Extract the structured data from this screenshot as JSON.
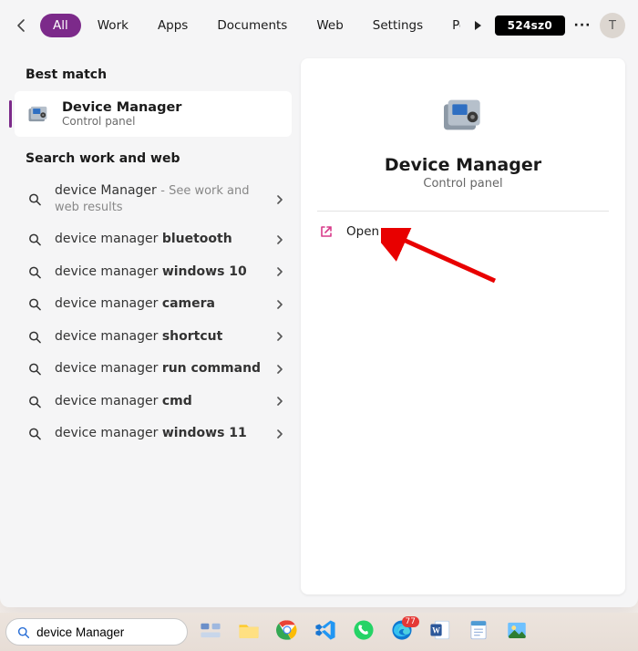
{
  "header": {
    "tabs": [
      "All",
      "Work",
      "Apps",
      "Documents",
      "Web",
      "Settings",
      "People"
    ],
    "active_tab_index": 0,
    "badge": "524sz0",
    "avatar_initial": "T"
  },
  "left": {
    "best_match_heading": "Best match",
    "best_match": {
      "title": "Device Manager",
      "subtitle": "Control panel"
    },
    "search_heading": "Search work and web",
    "suggestions": [
      {
        "prefix": "device Manager",
        "bold": "",
        "hint": "See work and web results"
      },
      {
        "prefix": "device manager ",
        "bold": "bluetooth",
        "hint": ""
      },
      {
        "prefix": "device manager ",
        "bold": "windows 10",
        "hint": ""
      },
      {
        "prefix": "device manager ",
        "bold": "camera",
        "hint": ""
      },
      {
        "prefix": "device manager ",
        "bold": "shortcut",
        "hint": ""
      },
      {
        "prefix": "device manager ",
        "bold": "run command",
        "hint": ""
      },
      {
        "prefix": "device manager ",
        "bold": "cmd",
        "hint": ""
      },
      {
        "prefix": "device manager ",
        "bold": "windows 11",
        "hint": ""
      }
    ]
  },
  "right": {
    "title": "Device Manager",
    "subtitle": "Control panel",
    "action_label": "Open"
  },
  "taskbar": {
    "search_value": "device Manager",
    "icons": [
      {
        "name": "task-view-icon",
        "badge": ""
      },
      {
        "name": "file-explorer-icon",
        "badge": ""
      },
      {
        "name": "chrome-icon",
        "badge": ""
      },
      {
        "name": "vscode-icon",
        "badge": ""
      },
      {
        "name": "whatsapp-icon",
        "badge": ""
      },
      {
        "name": "edge-icon",
        "badge": "77"
      },
      {
        "name": "word-icon",
        "badge": ""
      },
      {
        "name": "notepad-icon",
        "badge": ""
      },
      {
        "name": "photos-icon",
        "badge": ""
      }
    ]
  },
  "annotation": {
    "arrow": "points-to-open"
  }
}
